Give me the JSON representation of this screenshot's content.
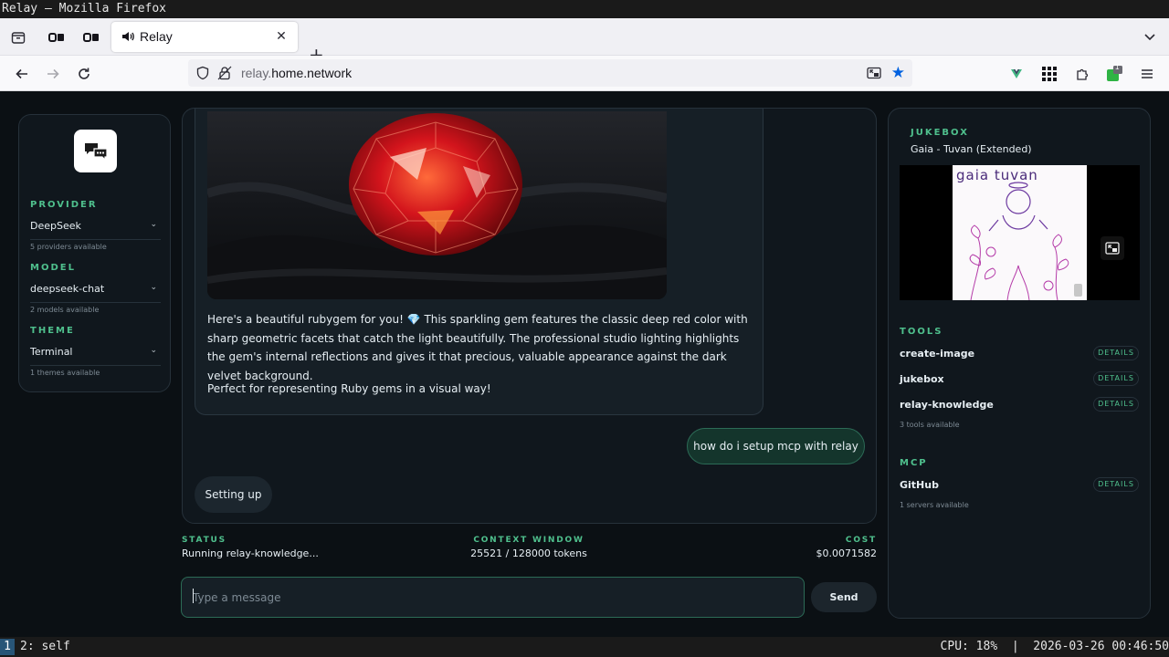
{
  "os": {
    "window_title": "Relay — Mozilla Firefox",
    "workspace_active": "1",
    "workspace_other": "2: self",
    "sysinfo": "CPU: 18%  |  2026-03-26 00:46:50"
  },
  "browser": {
    "tab_title": "Relay",
    "url_prefix": "relay.",
    "url_rest": "home.network",
    "extension_badge": "1"
  },
  "sidebar": {
    "provider": {
      "title": "PROVIDER",
      "value": "DeepSeek",
      "hint": "5 providers available"
    },
    "model": {
      "title": "MODEL",
      "value": "deepseek-chat",
      "hint": "2 models available"
    },
    "theme": {
      "title": "THEME",
      "value": "Terminal",
      "hint": "1 themes available"
    }
  },
  "chat": {
    "assistant_text_1": "Here's a beautiful rubygem for you! 💎 This sparkling gem features the classic deep red color with sharp geometric facets that catch the light beautifully. The professional studio lighting highlights the gem's internal reflections and gives it that precious, valuable appearance against the dark velvet background.",
    "assistant_text_2": "Perfect for representing Ruby gems in a visual way!",
    "user_message": "how do i setup mcp with relay",
    "typing_message": "Setting up"
  },
  "status": {
    "status_label": "STATUS",
    "status_value": "Running relay-knowledge...",
    "context_label": "CONTEXT WINDOW",
    "context_value": "25521 / 128000 tokens",
    "cost_label": "COST",
    "cost_value": "$0.0071582"
  },
  "composer": {
    "placeholder": "Type a message",
    "send_label": "Send"
  },
  "right": {
    "jukebox_title": "JUKEBOX",
    "now_playing": "Gaia - Tuvan (Extended)",
    "album_text": "gaia tuvan",
    "tools_title": "TOOLS",
    "tools": [
      {
        "name": "create-image",
        "action": "DETAILS"
      },
      {
        "name": "jukebox",
        "action": "DETAILS"
      },
      {
        "name": "relay-knowledge",
        "action": "DETAILS"
      }
    ],
    "tools_hint": "3 tools available",
    "mcp_title": "MCP",
    "servers": [
      {
        "name": "GitHub",
        "action": "DETAILS"
      }
    ],
    "servers_hint": "1 servers available"
  }
}
